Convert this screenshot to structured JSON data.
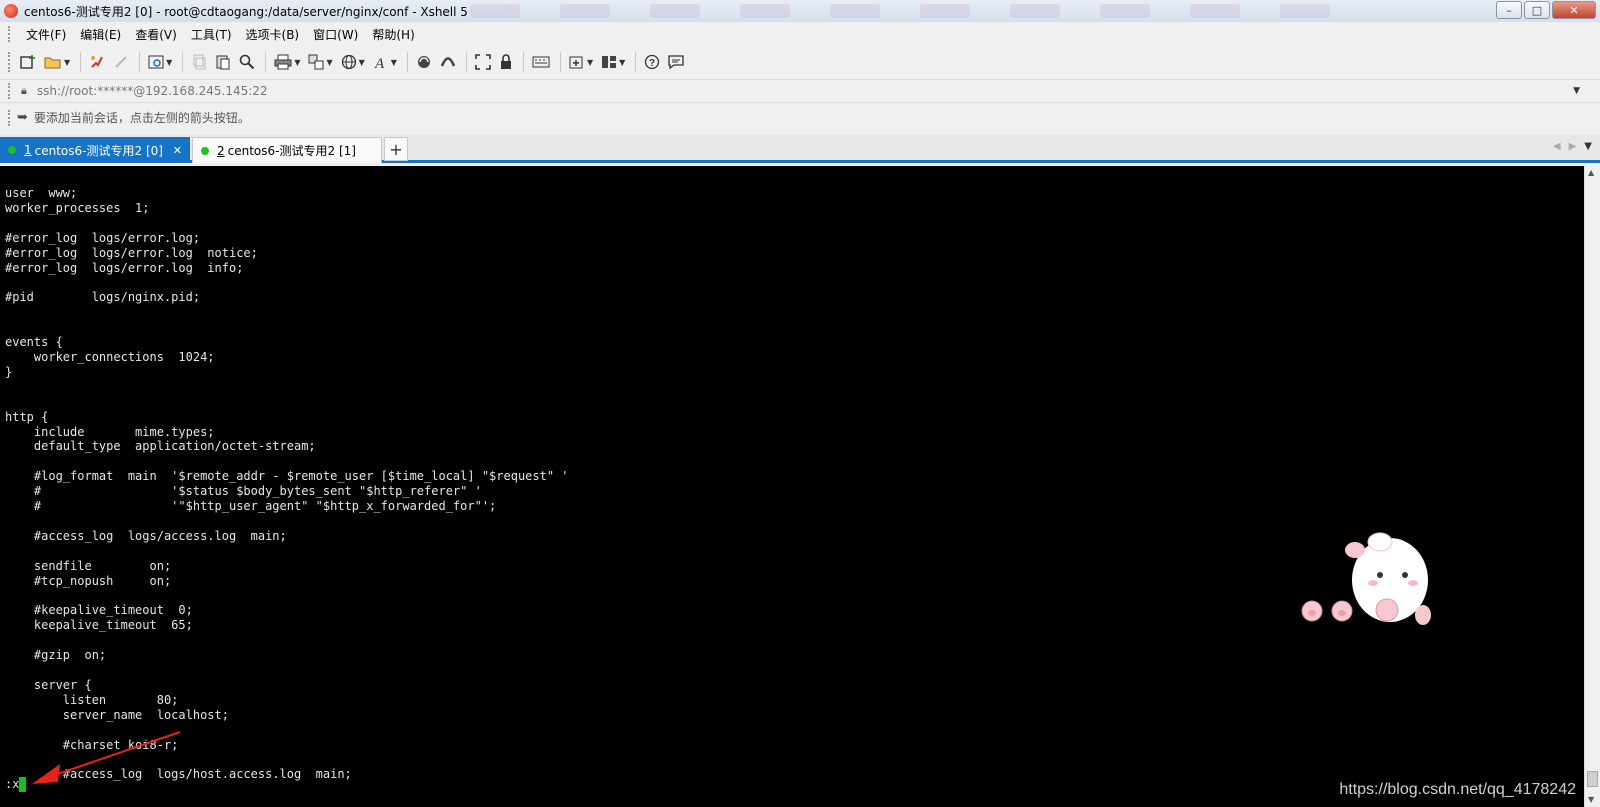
{
  "window": {
    "title": "centos6-测试专用2 [0] - root@cdtaogang:/data/server/nginx/conf - Xshell 5",
    "buttons": {
      "minimize": "–",
      "maximize": "□",
      "close": "✕"
    }
  },
  "menubar": {
    "items": [
      "文件(F)",
      "编辑(E)",
      "查看(V)",
      "工具(T)",
      "选项卡(B)",
      "窗口(W)",
      "帮助(H)"
    ]
  },
  "toolbar": {
    "icons": [
      "new-session-icon",
      "open-folder-icon",
      "reconnect-icon",
      "disconnect-icon",
      "properties-icon",
      "copy-icon",
      "paste-icon",
      "find-icon",
      "print-icon",
      "transfer-icon",
      "globe-icon",
      "font-icon",
      "xftp-icon",
      "xmanager-icon",
      "fullscreen-icon",
      "lock-icon",
      "keyboard-icon",
      "add-tab-icon",
      "layout-icon",
      "help-icon",
      "chat-icon"
    ]
  },
  "address": {
    "value": "ssh://root:******@192.168.245.145:22"
  },
  "hint": {
    "text": "要添加当前会话，点击左侧的箭头按钮。"
  },
  "tabs": [
    {
      "num": "1",
      "label": "centos6-测试专用2 [0]",
      "active": true
    },
    {
      "num": "2",
      "label": "centos6-测试专用2 [1]",
      "active": false
    }
  ],
  "terminal": {
    "lines": [
      "user  www;",
      "worker_processes  1;",
      "",
      "#error_log  logs/error.log;",
      "#error_log  logs/error.log  notice;",
      "#error_log  logs/error.log  info;",
      "",
      "#pid        logs/nginx.pid;",
      "",
      "",
      "events {",
      "    worker_connections  1024;",
      "}",
      "",
      "",
      "http {",
      "    include       mime.types;",
      "    default_type  application/octet-stream;",
      "",
      "    #log_format  main  '$remote_addr - $remote_user [$time_local] \"$request\" '",
      "    #                  '$status $body_bytes_sent \"$http_referer\" '",
      "    #                  '\"$http_user_agent\" \"$http_x_forwarded_for\"';",
      "",
      "    #access_log  logs/access.log  main;",
      "",
      "    sendfile        on;",
      "    #tcp_nopush     on;",
      "",
      "    #keepalive_timeout  0;",
      "    keepalive_timeout  65;",
      "",
      "    #gzip  on;",
      "",
      "    server {",
      "        listen       80;",
      "        server_name  localhost;",
      "",
      "        #charset koi8-r;",
      "",
      "        #access_log  logs/host.access.log  main;"
    ],
    "command": ":x"
  },
  "watermark": "https://blog.csdn.net/qq_4178242",
  "colors": {
    "accent": "#1673c6",
    "terminal_bg": "#000000",
    "terminal_fg": "#e6e6e6",
    "cursor": "#16c216",
    "status_dot": "#1fc01f",
    "annotation_arrow": "#e8231b"
  }
}
